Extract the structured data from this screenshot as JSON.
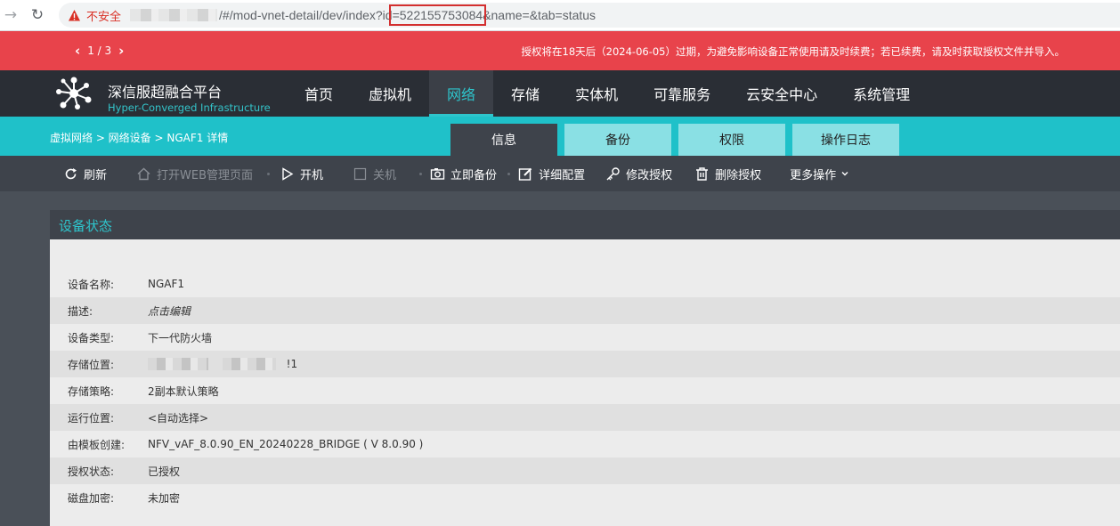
{
  "browser": {
    "insecure_label": "不安全",
    "url_path": "/#/mod-vnet-detail/dev/index?id",
    "url_id": "=522155753084",
    "url_rest": "&name=&tab=status"
  },
  "banner": {
    "pager": "1 / 3",
    "message": "授权将在18天后（2024-06-05）过期，为避免影响设备正常使用请及时续费；若已续费，请及时获取授权文件并导入。"
  },
  "header": {
    "brand_cn": "深信服超融合平台",
    "brand_en": "Hyper-Converged Infrastructure",
    "nav": [
      {
        "label": "首页"
      },
      {
        "label": "虚拟机"
      },
      {
        "label": "网络"
      },
      {
        "label": "存储"
      },
      {
        "label": "实体机"
      },
      {
        "label": "可靠服务"
      },
      {
        "label": "云安全中心"
      },
      {
        "label": "系统管理"
      }
    ]
  },
  "subbar": {
    "breadcrumb": "虚拟网络 > 网络设备 > NGAF1 详情",
    "tabs": [
      {
        "label": "信息"
      },
      {
        "label": "备份"
      },
      {
        "label": "权限"
      },
      {
        "label": "操作日志"
      }
    ]
  },
  "toolbar": {
    "refresh": "刷新",
    "open_web": "打开WEB管理页面",
    "power_on": "开机",
    "power_off": "关机",
    "backup_now": "立即备份",
    "detail_config": "详细配置",
    "modify_license": "修改授权",
    "delete_license": "删除授权",
    "more": "更多操作"
  },
  "panel": {
    "title": "设备状态",
    "rows": [
      {
        "label": "设备名称:",
        "value": "NGAF1"
      },
      {
        "label": "描述:",
        "value": "点击编辑"
      },
      {
        "label": "设备类型:",
        "value": "下一代防火墙"
      },
      {
        "label": "存储位置:",
        "value": "!1"
      },
      {
        "label": "存储策略:",
        "value": "2副本默认策略"
      },
      {
        "label": "运行位置:",
        "value": "<自动选择>"
      },
      {
        "label": "由模板创建:",
        "value": "NFV_vAF_8.0.90_EN_20240228_BRIDGE ( V 8.0.90 )"
      },
      {
        "label": "授权状态:",
        "value": "已授权"
      },
      {
        "label": "磁盘加密:",
        "value": "未加密"
      }
    ]
  },
  "colors": {
    "teal": "#1fc1c9",
    "banner_red": "#e8434b",
    "header_dark": "#2a2e35",
    "toolbar_dark": "#3e434b"
  }
}
